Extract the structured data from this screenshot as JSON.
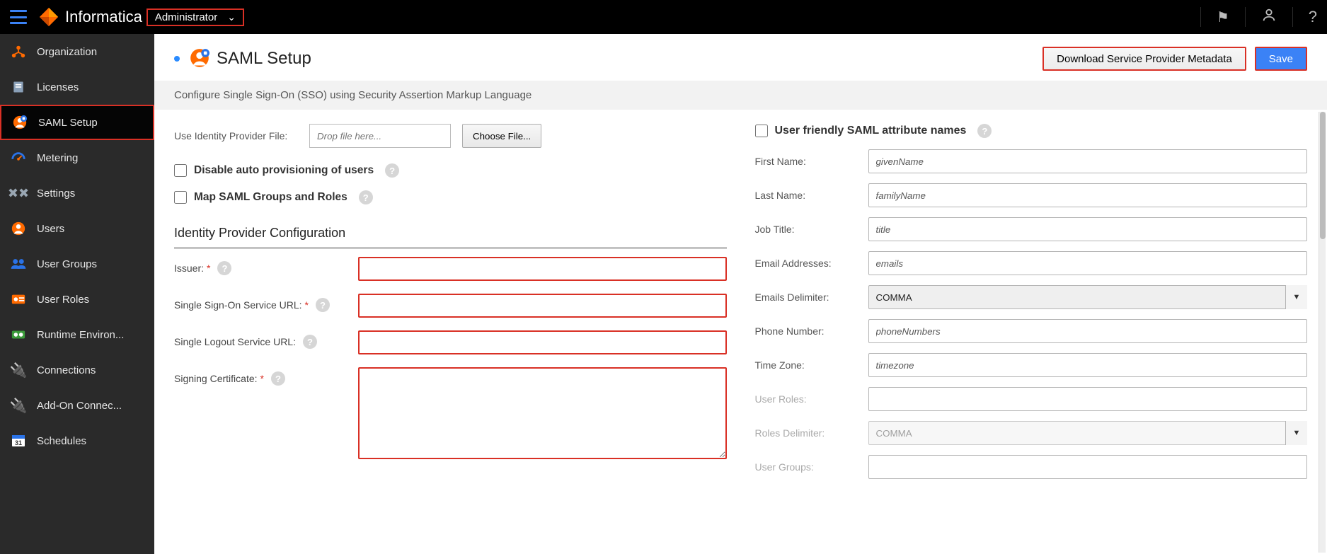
{
  "header": {
    "brand": "Informatica",
    "app_switcher": "Administrator"
  },
  "sidebar": {
    "items": [
      {
        "label": "Organization"
      },
      {
        "label": "Licenses"
      },
      {
        "label": "SAML Setup"
      },
      {
        "label": "Metering"
      },
      {
        "label": "Settings"
      },
      {
        "label": "Users"
      },
      {
        "label": "User Groups"
      },
      {
        "label": "User Roles"
      },
      {
        "label": "Runtime Environ..."
      },
      {
        "label": "Connections"
      },
      {
        "label": "Add-On Connec..."
      },
      {
        "label": "Schedules"
      }
    ]
  },
  "page": {
    "title": "SAML Setup",
    "subtitle": "Configure Single Sign-On (SSO) using Security Assertion Markup Language",
    "download_btn": "Download Service Provider Metadata",
    "save_btn": "Save"
  },
  "form_left": {
    "use_idp_file_label": "Use Identity Provider File:",
    "drop_placeholder": "Drop file here...",
    "choose_file": "Choose File...",
    "disable_autoprov": "Disable auto provisioning of users",
    "map_groups": "Map SAML Groups and Roles",
    "section_title": "Identity Provider Configuration",
    "issuer_label": "Issuer:",
    "sso_url_label": "Single Sign-On Service URL:",
    "slo_url_label": "Single Logout Service URL:",
    "cert_label": "Signing Certificate:",
    "issuer_value": "",
    "sso_url_value": "",
    "slo_url_value": "",
    "cert_value": ""
  },
  "form_right": {
    "friendly_names": "User friendly SAML attribute names",
    "first_name_label": "First Name:",
    "last_name_label": "Last Name:",
    "job_title_label": "Job Title:",
    "email_label": "Email Addresses:",
    "emails_delim_label": "Emails Delimiter:",
    "phone_label": "Phone Number:",
    "tz_label": "Time Zone:",
    "user_roles_label": "User Roles:",
    "roles_delim_label": "Roles Delimiter:",
    "user_groups_label": "User Groups:",
    "first_name_value": "givenName",
    "last_name_value": "familyName",
    "job_title_value": "title",
    "email_value": "emails",
    "phone_value": "phoneNumbers",
    "tz_value": "timezone",
    "user_roles_value": "",
    "user_groups_value": "",
    "delimiter_selected": "COMMA"
  }
}
